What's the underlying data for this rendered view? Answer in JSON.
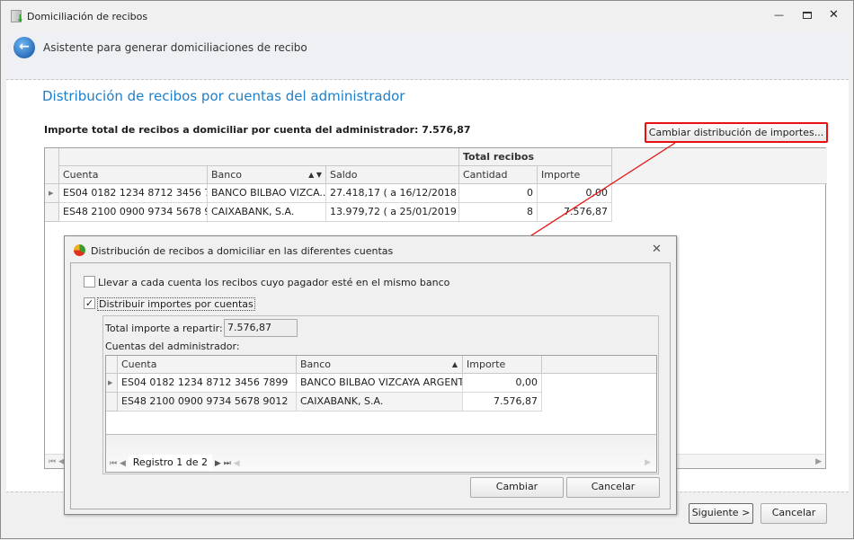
{
  "window": {
    "title": "Domiciliación de recibos"
  },
  "header": {
    "title": "Asistente para generar domiciliaciones de recibo"
  },
  "main": {
    "section_title": "Distribución de recibos por cuentas del administrador",
    "total_label": "Importe total de recibos a domiciliar por cuenta del administrador: 7.576,87",
    "change_button": "Cambiar distribución de importes...",
    "grid": {
      "band": "Total recibos",
      "columns": [
        "Cuenta",
        "Banco",
        "Saldo",
        "Cantidad",
        "Importe"
      ],
      "rows": [
        {
          "cuenta": "ES04 0182 1234 8712 3456 7...",
          "banco": "BANCO BILBAO VIZCA...",
          "saldo": "27.418,17 ( a 16/12/2018 )",
          "cantidad": "0",
          "importe": "0,00"
        },
        {
          "cuenta": "ES48 2100 0900 9734 5678 9...",
          "banco": "CAIXABANK, S.A.",
          "saldo": "13.979,72 ( a 25/01/2019 )",
          "cantidad": "8",
          "importe": "7.576,87"
        }
      ]
    }
  },
  "dialog": {
    "title": "Distribución de recibos a domiciliar en las diferentes cuentas",
    "checkbox1": {
      "label": "Llevar a cada cuenta los recibos cuyo pagador esté en el mismo banco",
      "checked": false
    },
    "checkbox2": {
      "label": "Distribuir importes por cuentas",
      "checked": true
    },
    "total_label": "Total importe a repartir:",
    "total_value": "7.576,87",
    "accounts_label": "Cuentas del administrador:",
    "grid": {
      "columns": [
        "Cuenta",
        "Banco",
        "Importe"
      ],
      "rows": [
        {
          "cuenta": "ES04 0182 1234 8712 3456 7899",
          "banco": "BANCO BILBAO VIZCAYA ARGENT...",
          "importe": "0,00"
        },
        {
          "cuenta": "ES48 2100 0900 9734 5678 9012",
          "banco": "CAIXABANK, S.A.",
          "importe": "7.576,87"
        }
      ],
      "navigator": "Registro 1 de 2"
    },
    "ok_button": "Cambiar",
    "cancel_button": "Cancelar"
  },
  "footer": {
    "next_button": "Siguiente >",
    "cancel_button": "Cancelar"
  },
  "colors": {
    "accent": "#1e7fc8",
    "highlight": "#e81010"
  }
}
